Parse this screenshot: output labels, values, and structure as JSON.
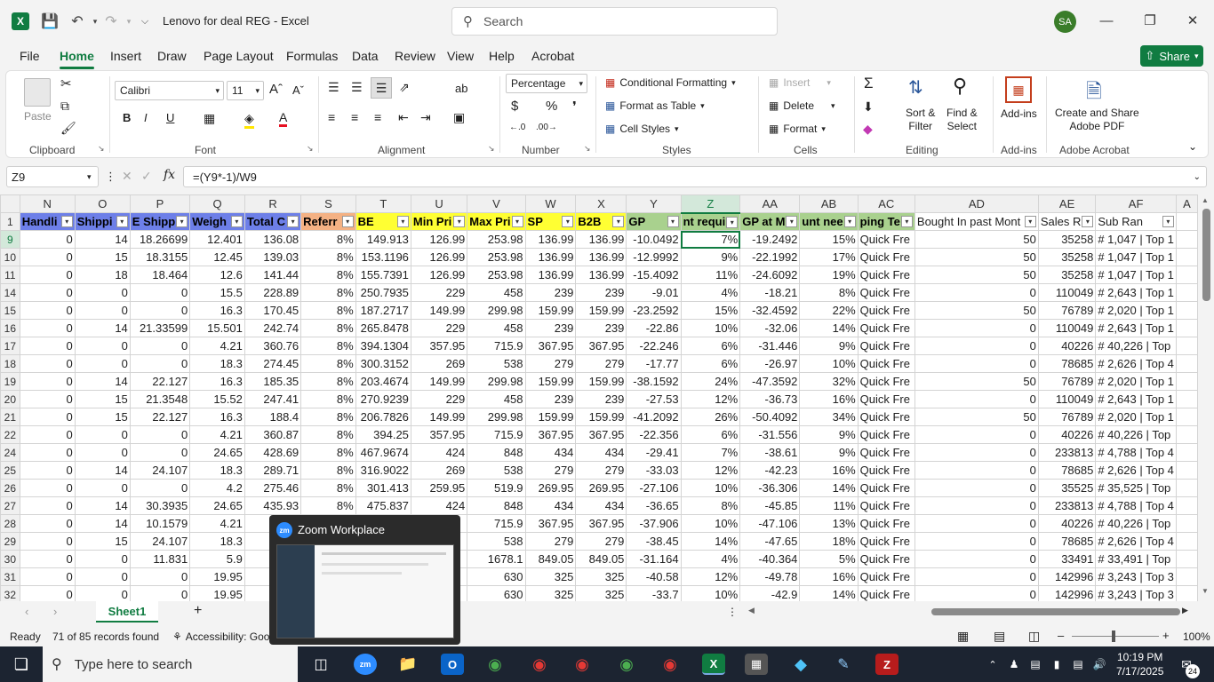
{
  "window": {
    "title": "Lenovo for deal REG  -  Excel",
    "search_placeholder": "Search",
    "avatar": "SA"
  },
  "tabs": [
    "File",
    "Home",
    "Insert",
    "Draw",
    "Page Layout",
    "Formulas",
    "Data",
    "Review",
    "View",
    "Help",
    "Acrobat"
  ],
  "share_label": "Share",
  "ribbon": {
    "clipboard": {
      "paste": "Paste",
      "label": "Clipboard"
    },
    "font": {
      "name": "Calibri",
      "size": "11",
      "label": "Font"
    },
    "alignment": {
      "label": "Alignment"
    },
    "number": {
      "format": "Percentage",
      "label": "Number"
    },
    "styles": {
      "cond_fmt": "Conditional Formatting",
      "format_table": "Format as Table",
      "cell_styles": "Cell Styles",
      "label": "Styles"
    },
    "cells": {
      "insert": "Insert",
      "delete": "Delete",
      "format": "Format",
      "label": "Cells"
    },
    "editing": {
      "sort": "Sort &",
      "filter": "Filter",
      "find": "Find &",
      "select": "Select",
      "label": "Editing"
    },
    "addins": {
      "name": "Add-ins",
      "label": "Add-ins"
    },
    "acrobat": {
      "line1": "Create and Share",
      "line2": "Adobe PDF",
      "label": "Adobe Acrobat"
    }
  },
  "formula_bar": {
    "cell": "Z9",
    "formula": "=(Y9*-1)/W9"
  },
  "columns": [
    "N",
    "O",
    "P",
    "Q",
    "R",
    "S",
    "T",
    "U",
    "V",
    "W",
    "X",
    "Y",
    "Z",
    "AA",
    "AB",
    "AC",
    "AD",
    "AE",
    "AF",
    "A"
  ],
  "header_row": [
    "Handli",
    "Shippi",
    "E Shipp",
    "Weigh",
    "Total C",
    "Referr",
    "BE",
    "Min Pri",
    "Max Pri",
    "SP",
    "B2B",
    "GP",
    "nt requi",
    "GP at M",
    "unt nee",
    "ping Te",
    "Bought In past Mont",
    "Sales R",
    "Sub Ran"
  ],
  "rows": [
    {
      "n": "9",
      "c": [
        "0",
        "14",
        "18.26699",
        "12.401",
        "136.08",
        "8%",
        "149.913",
        "126.99",
        "253.98",
        "136.99",
        "136.99",
        "-10.0492",
        "7%",
        "-19.2492",
        "15%",
        "Quick Fre",
        "50",
        "35258",
        "# 1,047 | Top 1"
      ]
    },
    {
      "n": "10",
      "c": [
        "0",
        "15",
        "18.3155",
        "12.45",
        "139.03",
        "8%",
        "153.1196",
        "126.99",
        "253.98",
        "136.99",
        "136.99",
        "-12.9992",
        "9%",
        "-22.1992",
        "17%",
        "Quick Fre",
        "50",
        "35258",
        "# 1,047 | Top 1"
      ]
    },
    {
      "n": "11",
      "c": [
        "0",
        "18",
        "18.464",
        "12.6",
        "141.44",
        "8%",
        "155.7391",
        "126.99",
        "253.98",
        "136.99",
        "136.99",
        "-15.4092",
        "11%",
        "-24.6092",
        "19%",
        "Quick Fre",
        "50",
        "35258",
        "# 1,047 | Top 1"
      ]
    },
    {
      "n": "14",
      "c": [
        "0",
        "0",
        "0",
        "15.5",
        "228.89",
        "8%",
        "250.7935",
        "229",
        "458",
        "239",
        "239",
        "-9.01",
        "4%",
        "-18.21",
        "8%",
        "Quick Fre",
        "0",
        "110049",
        "# 2,643 | Top 1"
      ]
    },
    {
      "n": "15",
      "c": [
        "0",
        "0",
        "0",
        "16.3",
        "170.45",
        "8%",
        "187.2717",
        "149.99",
        "299.98",
        "159.99",
        "159.99",
        "-23.2592",
        "15%",
        "-32.4592",
        "22%",
        "Quick Fre",
        "50",
        "76789",
        "# 2,020 | Top 1"
      ]
    },
    {
      "n": "16",
      "c": [
        "0",
        "14",
        "21.33599",
        "15.501",
        "242.74",
        "8%",
        "265.8478",
        "229",
        "458",
        "239",
        "239",
        "-22.86",
        "10%",
        "-32.06",
        "14%",
        "Quick Fre",
        "0",
        "110049",
        "# 2,643 | Top 1"
      ]
    },
    {
      "n": "17",
      "c": [
        "0",
        "0",
        "0",
        "4.21",
        "360.76",
        "8%",
        "394.1304",
        "357.95",
        "715.9",
        "367.95",
        "367.95",
        "-22.246",
        "6%",
        "-31.446",
        "9%",
        "Quick Fre",
        "0",
        "40226",
        "# 40,226 | Top"
      ]
    },
    {
      "n": "18",
      "c": [
        "0",
        "0",
        "0",
        "18.3",
        "274.45",
        "8%",
        "300.3152",
        "269",
        "538",
        "279",
        "279",
        "-17.77",
        "6%",
        "-26.97",
        "10%",
        "Quick Fre",
        "0",
        "78685",
        "# 2,626 | Top 4"
      ]
    },
    {
      "n": "19",
      "c": [
        "0",
        "14",
        "22.127",
        "16.3",
        "185.35",
        "8%",
        "203.4674",
        "149.99",
        "299.98",
        "159.99",
        "159.99",
        "-38.1592",
        "24%",
        "-47.3592",
        "32%",
        "Quick Fre",
        "50",
        "76789",
        "# 2,020 | Top 1"
      ]
    },
    {
      "n": "20",
      "c": [
        "0",
        "15",
        "21.3548",
        "15.52",
        "247.41",
        "8%",
        "270.9239",
        "229",
        "458",
        "239",
        "239",
        "-27.53",
        "12%",
        "-36.73",
        "16%",
        "Quick Fre",
        "0",
        "110049",
        "# 2,643 | Top 1"
      ]
    },
    {
      "n": "21",
      "c": [
        "0",
        "15",
        "22.127",
        "16.3",
        "188.4",
        "8%",
        "206.7826",
        "149.99",
        "299.98",
        "159.99",
        "159.99",
        "-41.2092",
        "26%",
        "-50.4092",
        "34%",
        "Quick Fre",
        "50",
        "76789",
        "# 2,020 | Top 1"
      ]
    },
    {
      "n": "22",
      "c": [
        "0",
        "0",
        "0",
        "4.21",
        "360.87",
        "8%",
        "394.25",
        "357.95",
        "715.9",
        "367.95",
        "367.95",
        "-22.356",
        "6%",
        "-31.556",
        "9%",
        "Quick Fre",
        "0",
        "40226",
        "# 40,226 | Top"
      ]
    },
    {
      "n": "24",
      "c": [
        "0",
        "0",
        "0",
        "24.65",
        "428.69",
        "8%",
        "467.9674",
        "424",
        "848",
        "434",
        "434",
        "-29.41",
        "7%",
        "-38.61",
        "9%",
        "Quick Fre",
        "0",
        "233813",
        "# 4,788 | Top 4"
      ]
    },
    {
      "n": "25",
      "c": [
        "0",
        "14",
        "24.107",
        "18.3",
        "289.71",
        "8%",
        "316.9022",
        "269",
        "538",
        "279",
        "279",
        "-33.03",
        "12%",
        "-42.23",
        "16%",
        "Quick Fre",
        "0",
        "78685",
        "# 2,626 | Top 4"
      ]
    },
    {
      "n": "26",
      "c": [
        "0",
        "0",
        "0",
        "4.2",
        "275.46",
        "8%",
        "301.413",
        "259.95",
        "519.9",
        "269.95",
        "269.95",
        "-27.106",
        "10%",
        "-36.306",
        "14%",
        "Quick Fre",
        "0",
        "35525",
        "# 35,525 | Top"
      ]
    },
    {
      "n": "27",
      "c": [
        "0",
        "14",
        "30.3935",
        "24.65",
        "435.93",
        "8%",
        "475.837",
        "424",
        "848",
        "434",
        "434",
        "-36.65",
        "8%",
        "-45.85",
        "11%",
        "Quick Fre",
        "0",
        "233813",
        "# 4,788 | Top 4"
      ]
    },
    {
      "n": "28",
      "c": [
        "0",
        "14",
        "10.1579",
        "4.21",
        "",
        "",
        "",
        "",
        "715.9",
        "367.95",
        "367.95",
        "-37.906",
        "10%",
        "-47.106",
        "13%",
        "Quick Fre",
        "0",
        "40226",
        "# 40,226 | Top"
      ]
    },
    {
      "n": "29",
      "c": [
        "0",
        "15",
        "24.107",
        "18.3",
        "",
        "",
        "",
        "",
        "538",
        "279",
        "279",
        "-38.45",
        "14%",
        "-47.65",
        "18%",
        "Quick Fre",
        "0",
        "78685",
        "# 2,626 | Top 4"
      ]
    },
    {
      "n": "30",
      "c": [
        "0",
        "0",
        "11.831",
        "5.9",
        "",
        "",
        "",
        "",
        "1678.1",
        "849.05",
        "849.05",
        "-31.164",
        "4%",
        "-40.364",
        "5%",
        "Quick Fre",
        "0",
        "33491",
        "# 33,491 | Top"
      ]
    },
    {
      "n": "31",
      "c": [
        "0",
        "0",
        "0",
        "19.95",
        "",
        "",
        "",
        "",
        "630",
        "325",
        "325",
        "-40.58",
        "12%",
        "-49.78",
        "16%",
        "Quick Fre",
        "0",
        "142996",
        "# 3,243 | Top 3"
      ]
    },
    {
      "n": "32",
      "c": [
        "0",
        "0",
        "0",
        "19.95",
        "",
        "",
        "",
        "",
        "630",
        "325",
        "325",
        "-33.7",
        "10%",
        "-42.9",
        "14%",
        "Quick Fre",
        "0",
        "142996",
        "# 3,243 | Top 3"
      ]
    }
  ],
  "sheet_tab": "Sheet1",
  "status": {
    "ready": "Ready",
    "records": "71 of 85 records found",
    "accessibility": "Accessibility: Goo",
    "zoom": "100%"
  },
  "zoom_popup": {
    "title": "Zoom Workplace"
  },
  "taskbar": {
    "search_placeholder": "Type here to search",
    "time": "10:19 PM",
    "date": "7/17/2025",
    "badge": "24"
  }
}
